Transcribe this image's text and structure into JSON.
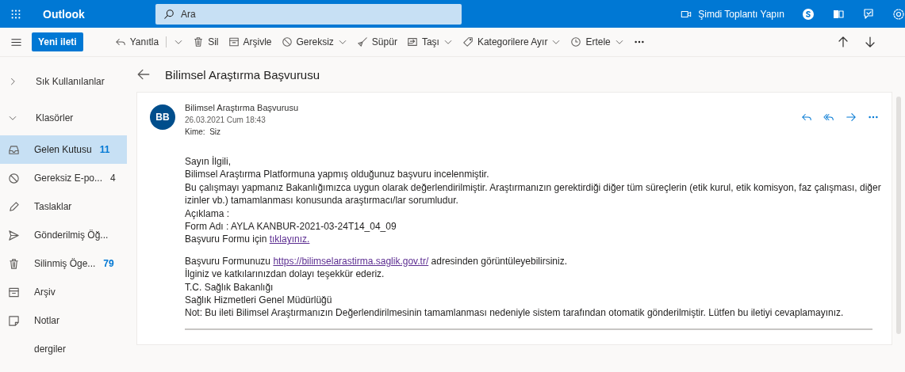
{
  "app": {
    "title": "Outlook"
  },
  "search": {
    "placeholder": "Ara"
  },
  "header_actions": {
    "meeting": "Şimdi Toplantı Yapın"
  },
  "new_message_button": "Yeni ileti",
  "toolbar": [
    {
      "label": "Yanıtla",
      "dropdown": true,
      "split": true
    },
    {
      "label": "Sil",
      "dropdown": false,
      "split": false
    },
    {
      "label": "Arşivle",
      "dropdown": false,
      "split": false
    },
    {
      "label": "Gereksiz",
      "dropdown": true,
      "split": false
    },
    {
      "label": "Süpür",
      "dropdown": false,
      "split": false
    },
    {
      "label": "Taşı",
      "dropdown": true,
      "split": false
    },
    {
      "label": "Kategorilere Ayır",
      "dropdown": true,
      "split": false
    },
    {
      "label": "Ertele",
      "dropdown": true,
      "split": false
    }
  ],
  "sidebar": {
    "groups": [
      {
        "label": "Sık Kullanılanlar",
        "expanded": false
      },
      {
        "label": "Klasörler",
        "expanded": true
      }
    ],
    "items": [
      {
        "label": "Gelen Kutusu",
        "count": "11",
        "unread": true,
        "selected": true
      },
      {
        "label": "Gereksiz E-po...",
        "count": "4",
        "unread": false,
        "selected": false
      },
      {
        "label": "Taslaklar",
        "selected": false
      },
      {
        "label": "Gönderilmiş Öğ...",
        "selected": false
      },
      {
        "label": "Silinmiş Öge...",
        "count": "79",
        "unread": true,
        "selected": false
      },
      {
        "label": "Arşiv",
        "selected": false
      },
      {
        "label": "Notlar",
        "selected": false
      },
      {
        "label": "dergiler",
        "selected": false
      }
    ]
  },
  "message": {
    "subject": "Bilimsel Araştırma Başvurusu",
    "avatar": "BB",
    "sender": "Bilimsel Araştırma Başvurusu",
    "date": "26.03.2021 Cum 18:43",
    "to_label": "Kime:",
    "to": "Siz",
    "paragraphs": [
      [
        [
          {
            "text": "Sayın İlgili,"
          }
        ],
        [
          {
            "text": "Bilimsel Araştırma Platformuna yapmış olduğunuz başvuru incelenmiştir."
          }
        ],
        [
          {
            "text": "Bu çalışmayı yapmanız Bakanlığımızca uygun olarak değerlendirilmiştir. Araştırmanızın gerektirdiği diğer tüm süreçlerin (etik kurul, etik komisyon, faz çalışması, diğer izinler vb.) tamamlanması konusunda araştırmacı/lar sorumludur."
          }
        ],
        [
          {
            "text": "Açıklama :"
          }
        ],
        [
          {
            "text": "Form Adı :  AYLA KANBUR-2021-03-24T14_04_09"
          }
        ],
        [
          {
            "text": "Başvuru Formu için "
          },
          {
            "link": "tıklayınız."
          }
        ]
      ],
      [
        [
          {
            "text": "Başvuru Formunuzu "
          },
          {
            "link": "https://bilimselarastirma.saglik.gov.tr/"
          },
          {
            "text": " adresinden görüntüleyebilirsiniz."
          }
        ],
        [
          {
            "text": "İlginiz ve katkılarınızdan dolayı teşekkür ederiz."
          }
        ],
        [
          {
            "text": "T.C. Sağlık Bakanlığı"
          }
        ],
        [
          {
            "text": "Sağlık Hizmetleri Genel Müdürlüğü"
          }
        ],
        [
          {
            "text": "Not: Bu ileti Bilimsel Araştırmanızın Değerlendirilmesinin tamamlanması nedeniyle sistem tarafından otomatik gönderilmiştir. Lütfen bu iletiyi cevaplamayınız."
          }
        ]
      ]
    ]
  }
}
